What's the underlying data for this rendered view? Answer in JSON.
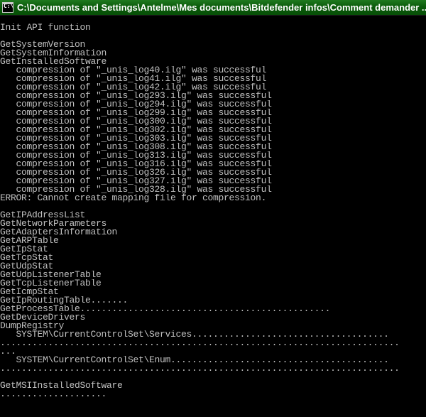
{
  "window": {
    "title": "C:\\Documents and Settings\\Antelme\\Mes documents\\Bitdefender infos\\Comment demander ..."
  },
  "console": {
    "lines": [
      "Init API function",
      "",
      "GetSystemVersion",
      "GetSystemInformation",
      "GetInstalledSoftware",
      "   compression of \"_unis_log40.ilg\" was successful",
      "   compression of \"_unis_log41.ilg\" was successful",
      "   compression of \"_unis_log42.ilg\" was successful",
      "   compression of \"_unis_log293.ilg\" was successful",
      "   compression of \"_unis_log294.ilg\" was successful",
      "   compression of \"_unis_log299.ilg\" was successful",
      "   compression of \"_unis_log300.ilg\" was successful",
      "   compression of \"_unis_log302.ilg\" was successful",
      "   compression of \"_unis_log303.ilg\" was successful",
      "   compression of \"_unis_log308.ilg\" was successful",
      "   compression of \"_unis_log313.ilg\" was successful",
      "   compression of \"_unis_log316.ilg\" was successful",
      "   compression of \"_unis_log326.ilg\" was successful",
      "   compression of \"_unis_log327.ilg\" was successful",
      "   compression of \"_unis_log328.ilg\" was successful",
      "ERROR: Cannot create mapping file for compression.",
      "",
      "GetIPAddressList",
      "GetNetworkParameters",
      "GetAdaptersInformation",
      "GetARPTable",
      "GetIpStat",
      "GetTcpStat",
      "GetUdpStat",
      "GetUdpListenerTable",
      "GetTcpListenerTable",
      "GetIcmpStat",
      "GetIpRoutingTable.......",
      "GetProcessTable...............................................",
      "GetDeviceDrivers",
      "DumpRegistry",
      "   SYSTEM\\CurrentControlSet\\Services.....................................",
      "...........................................................................",
      "...",
      "   SYSTEM\\CurrentControlSet\\Enum.........................................",
      "...........................................................................",
      "",
      "GetMSIInstalledSoftware",
      "...................."
    ]
  }
}
